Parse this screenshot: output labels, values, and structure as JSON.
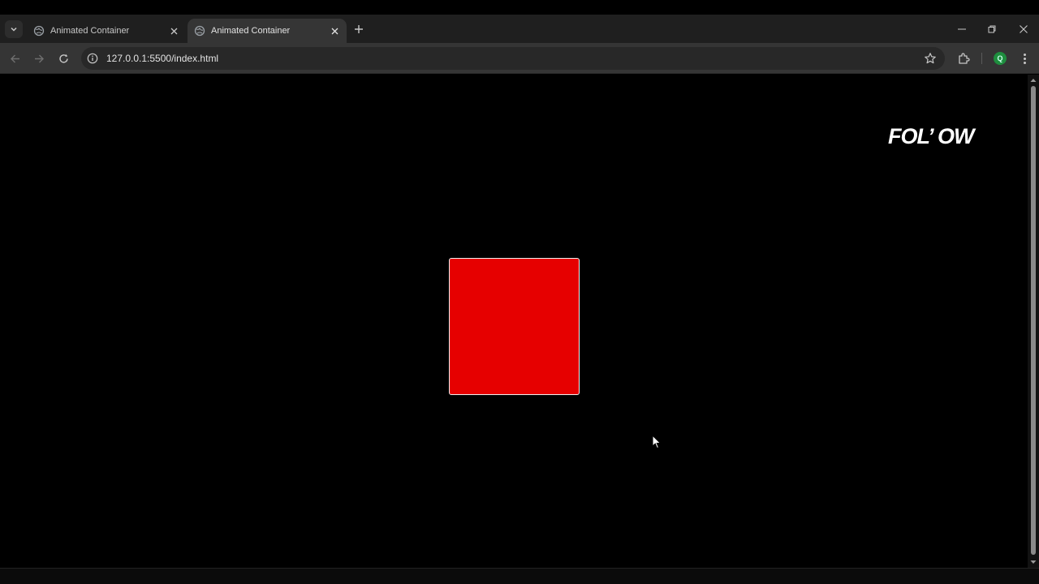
{
  "tabs": [
    {
      "title": "Animated Container",
      "active": false
    },
    {
      "title": "Animated Container",
      "active": true
    }
  ],
  "address_bar": {
    "url": "127.0.0.1:5500/index.html"
  },
  "profile": {
    "initial": "Q",
    "color": "#1e8e3e"
  },
  "page": {
    "logo_text": "FOL’ OW",
    "box_color": "#e60000",
    "background": "#000000"
  },
  "icons": {
    "tab_search": "chevron-down-icon",
    "tab_favicon": "globe-icon",
    "tab_close": "close-icon",
    "new_tab": "plus-icon",
    "back": "arrow-left-icon",
    "forward": "arrow-right-icon",
    "reload": "reload-icon",
    "site_info": "info-icon",
    "bookmark": "star-icon",
    "extensions": "puzzle-icon",
    "menu": "kebab-menu-icon"
  }
}
